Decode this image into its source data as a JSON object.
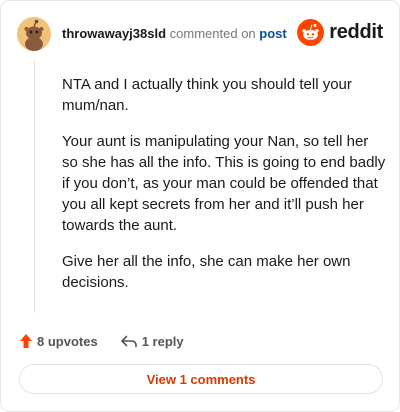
{
  "header": {
    "username": "throwawayj38sld",
    "action_text": "commented on",
    "post_link": "post",
    "brand_name": "reddit"
  },
  "comment": {
    "paragraphs": [
      "NTA and I actually think you should tell your mum/nan.",
      "Your aunt is manipulating your Nan, so tell her so she has all the info. This is going to end badly if you don’t, as your man could be offended that you all kept secrets from her and it’ll push her towards the aunt.",
      "Give her all the info, she can make her own decisions."
    ]
  },
  "actions": {
    "upvotes_label": "8 upvotes",
    "reply_label": "1 reply"
  },
  "view_comments_label": "View 1 comments",
  "colors": {
    "brand": "#ff4500",
    "view_button_text": "#d93a00",
    "post_link": "#0a4e99"
  },
  "icons": [
    "snoo-avatar-icon",
    "reddit-logo-icon",
    "upvote-arrow-icon",
    "reply-arrow-icon"
  ]
}
